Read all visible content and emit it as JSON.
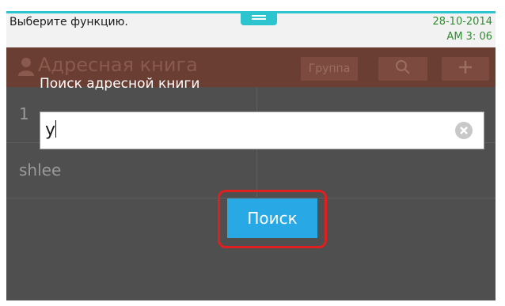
{
  "status": {
    "message": "Выберите функцию.",
    "date": "28-10-2014",
    "time": "AM 3: 06"
  },
  "header": {
    "title": "Адресная книга",
    "group_button": "Группа",
    "search_icon": "search-icon",
    "add_icon": "plus-icon"
  },
  "dialog": {
    "label": "Поиск адресной книги",
    "input_value": "у",
    "search_button": "Поиск"
  },
  "list": {
    "items": [
      "1",
      "shlee"
    ]
  },
  "colors": {
    "accent": "#29a8e6",
    "header_bg": "#6a3e33",
    "highlight": "#e02020",
    "status_green": "#2e8b2e"
  }
}
